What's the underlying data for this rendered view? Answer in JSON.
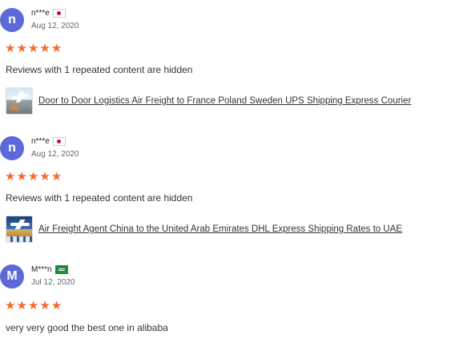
{
  "colors": {
    "avatar_bg": "#5b6ad6",
    "star": "#f7692a",
    "text": "#333333"
  },
  "reviews": [
    {
      "avatar_letter": "n",
      "username": "n***e",
      "country_flag": "japan-flag-icon",
      "date": "Aug 12, 2020",
      "rating": 5,
      "text": "Reviews with 1 repeated content are hidden",
      "product": {
        "thumbnail": "air-freight-logistics-thumbnail",
        "title": "Door to Door Logistics Air Freight to France Poland Sweden UPS Shipping Express Courier"
      }
    },
    {
      "avatar_letter": "n",
      "username": "n***e",
      "country_flag": "japan-flag-icon",
      "date": "Aug 12, 2020",
      "rating": 5,
      "text": "Reviews with 1 repeated content are hidden",
      "product": {
        "thumbnail": "air-freight-agent-thumbnail",
        "title": "Air Freight Agent China to the United Arab Emirates DHL Express Shipping Rates to UAE"
      }
    },
    {
      "avatar_letter": "M",
      "username": "M***n",
      "country_flag": "saudi-arabia-flag-icon",
      "date": "Jul 12, 2020",
      "rating": 5,
      "text": "very very good the best one in alibaba"
    }
  ]
}
